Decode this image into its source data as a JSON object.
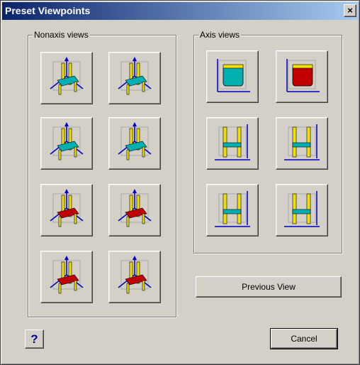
{
  "window": {
    "title": "Preset Viewpoints",
    "close_glyph": "×"
  },
  "nonaxis": {
    "label": "Nonaxis views",
    "buttons": [
      {
        "icon": "chair-view-top-front-icon"
      },
      {
        "icon": "chair-view-top-left-icon"
      },
      {
        "icon": "chair-view-top-back-left-icon"
      },
      {
        "icon": "chair-view-top-back-right-icon"
      },
      {
        "icon": "chair-view-bottom-front-icon"
      },
      {
        "icon": "chair-view-bottom-left-icon"
      },
      {
        "icon": "chair-view-bottom-back-left-icon"
      },
      {
        "icon": "chair-view-bottom-back-right-icon"
      }
    ]
  },
  "axis": {
    "label": "Axis views",
    "buttons": [
      {
        "icon": "chair-top-view-icon"
      },
      {
        "icon": "chair-bottom-view-icon"
      },
      {
        "icon": "chair-left-view-icon"
      },
      {
        "icon": "chair-right-view-icon"
      },
      {
        "icon": "chair-front-view-icon"
      },
      {
        "icon": "chair-back-view-icon"
      }
    ]
  },
  "previous_view_label": "Previous View",
  "cancel_label": "Cancel",
  "help_label": "?",
  "colors": {
    "seat_top": "#00b0b0",
    "seat_bottom": "#c00000",
    "frame": "#f0e000",
    "axis": "#0000c0"
  }
}
